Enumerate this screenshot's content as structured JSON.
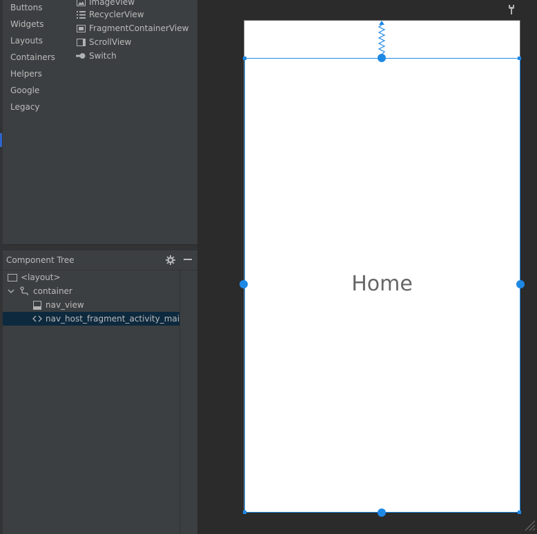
{
  "palette": {
    "categories": [
      "Buttons",
      "Widgets",
      "Layouts",
      "Containers",
      "Helpers",
      "Google",
      "Legacy"
    ],
    "items": [
      {
        "label": "ImageView",
        "icon": "image-icon"
      },
      {
        "label": "RecyclerView",
        "icon": "list-icon"
      },
      {
        "label": "FragmentContainerView",
        "icon": "fragment-icon"
      },
      {
        "label": "ScrollView",
        "icon": "scroll-icon"
      },
      {
        "label": "Switch",
        "icon": "switch-icon"
      }
    ]
  },
  "component_tree": {
    "title": "Component Tree",
    "nodes": [
      {
        "label": "<layout>",
        "icon": "layout-icon"
      },
      {
        "label": "container",
        "icon": "constraint-layout-icon"
      },
      {
        "label": "nav_view",
        "icon": "bottom-nav-icon"
      },
      {
        "label": "nav_host_fragment_activity_main",
        "icon": "code-tag-icon"
      }
    ]
  },
  "preview": {
    "text": "Home"
  },
  "colors": {
    "panel": "#3c3f41",
    "canvas": "#2b2b2b",
    "selection": "#0d293e",
    "accent": "#1e88e5"
  }
}
